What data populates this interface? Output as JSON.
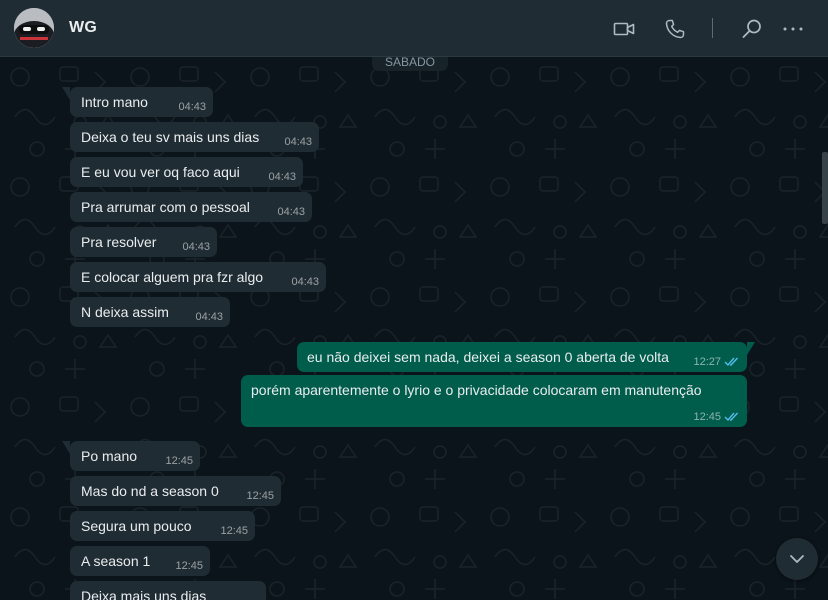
{
  "header": {
    "contact_name": "WG"
  },
  "icons": {
    "video": "video-camera-icon",
    "call": "phone-icon",
    "search": "search-icon",
    "menu": "more-vertical-icon"
  },
  "colors": {
    "header_bg": "#202c33",
    "chat_bg": "#0b141a",
    "incoming_bubble": "#202c33",
    "outgoing_bubble": "#005c4b",
    "read_ticks": "#53bdeb"
  },
  "chat": {
    "date_chip": "SÁBADO",
    "messages": [
      {
        "text": "Intro mano",
        "time": "04:43",
        "dir": "in"
      },
      {
        "text": "Deixa o teu sv mais uns dias",
        "time": "04:43",
        "dir": "in"
      },
      {
        "text": "E eu vou ver oq faco aqui",
        "time": "04:43",
        "dir": "in"
      },
      {
        "text": "Pra arrumar com o pessoal",
        "time": "04:43",
        "dir": "in"
      },
      {
        "text": "Pra resolver",
        "time": "04:43",
        "dir": "in"
      },
      {
        "text": "E colocar alguem pra fzr algo",
        "time": "04:43",
        "dir": "in"
      },
      {
        "text": "N deixa assim",
        "time": "04:43",
        "dir": "in"
      },
      {
        "text": "eu não deixei sem nada, deixei a season 0 aberta de volta",
        "time": "12:27",
        "dir": "out",
        "status": "read"
      },
      {
        "text": "porém aparentemente o lyrio e o privacidade colocaram em manutenção",
        "time": "12:45",
        "dir": "out",
        "status": "read"
      },
      {
        "text": "Po mano",
        "time": "12:45",
        "dir": "in"
      },
      {
        "text": "Mas do nd a season 0",
        "time": "12:45",
        "dir": "in"
      },
      {
        "text": "Segura um pouco",
        "time": "12:45",
        "dir": "in"
      },
      {
        "text": "A season 1",
        "time": "12:45",
        "dir": "in"
      },
      {
        "text": "Deixa mais uns dias",
        "time": "",
        "dir": "in"
      }
    ]
  }
}
